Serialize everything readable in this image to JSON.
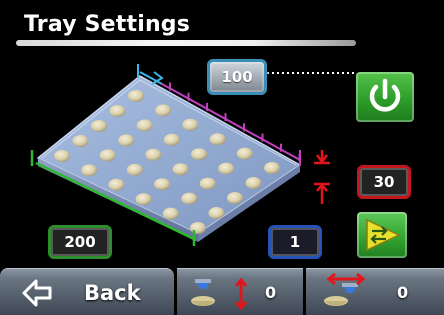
{
  "title": "Tray Settings",
  "settings": {
    "count_x": "100",
    "height": "30",
    "length": "200",
    "count_y": "1"
  },
  "bottom_bar": {
    "back_label": "Back",
    "move_y_value": "0",
    "move_x_value": "0"
  },
  "icons": {
    "power": "power-icon",
    "swap": "swap-icon",
    "back": "back-arrow-icon",
    "move_y": "vertical-move-icon",
    "move_x": "horizontal-move-icon"
  },
  "colors": {
    "background": "#000000",
    "count_x_accent": "#3a8fb8",
    "height_accent": "#c4161c",
    "length_accent": "#2c8f2c",
    "count_y_accent": "#2553b8",
    "tray": "#8fa8d0",
    "button_green": "#2e9e2a"
  }
}
